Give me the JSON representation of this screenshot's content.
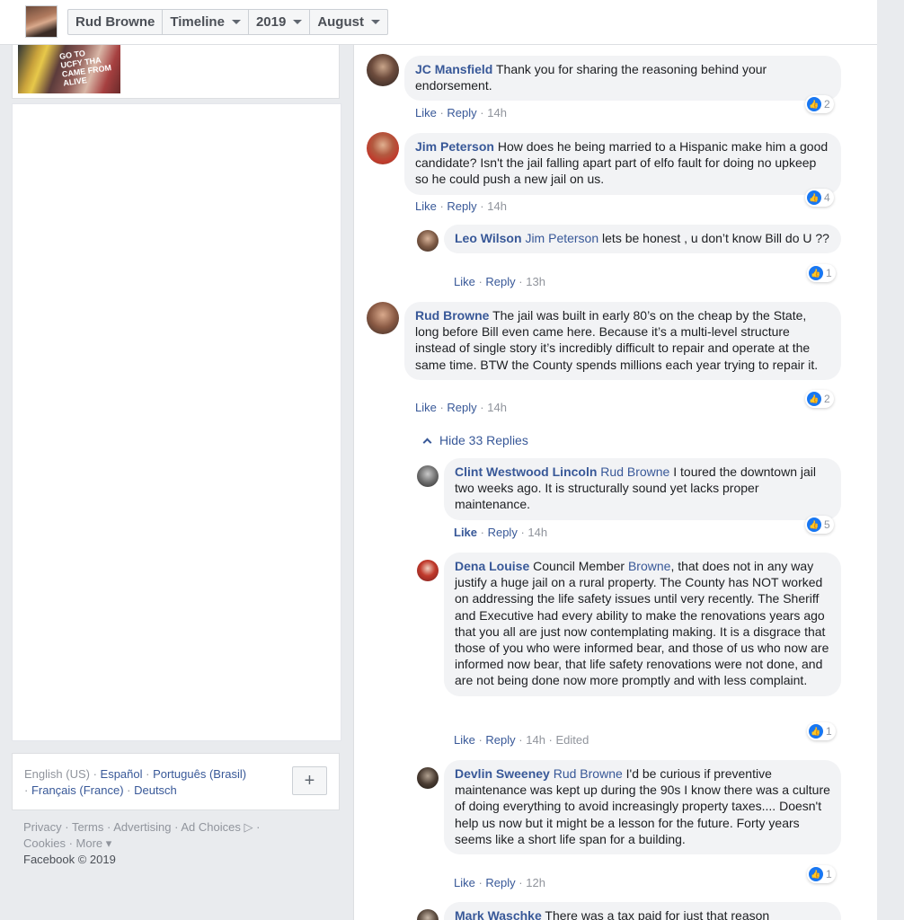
{
  "topbar": {
    "profile_name": "Rud Browne",
    "crumbs": [
      "Timeline",
      "2019",
      "August"
    ]
  },
  "left": {
    "photo_sign": "GO TO\nUCFY THA\nCAME FROM\nALIVE",
    "languages": {
      "current": "English (US)",
      "links": [
        "Español",
        "Português (Brasil)",
        "Français (France)",
        "Deutsch"
      ]
    },
    "footer": {
      "links": [
        "Privacy",
        "Terms",
        "Advertising",
        "Ad Choices",
        "Cookies",
        "More"
      ],
      "copyright": "Facebook © 2019"
    }
  },
  "comments": [
    {
      "author": "JC Mansfield",
      "mention": "",
      "text": "Thank you for sharing the reasoning behind your endorsement.",
      "like": "Like",
      "reply": "Reply",
      "time": "14h",
      "reactions": "2"
    },
    {
      "author": "Jim Peterson",
      "mention": "",
      "text": "How does he being married to a Hispanic make him a good candidate? Isn't the jail falling apart part of elfo fault for doing no upkeep so he could push a new jail on us.",
      "like": "Like",
      "reply": "Reply",
      "time": "14h",
      "reactions": "4"
    },
    {
      "author": "Leo Wilson",
      "mention": "Jim Peterson",
      "text": "lets be honest , u don’t know Bill do U ??",
      "like": "Like",
      "reply": "Reply",
      "time": "13h",
      "reactions": "1"
    },
    {
      "author": "Rud Browne",
      "mention": "",
      "text": "The jail was built in early 80’s on the cheap by the State, long before Bill even came here. Because it’s a multi-level structure instead of single story it’s incredibly difficult to repair and operate at the same time. BTW the County spends millions each year trying to repair it.",
      "like": "Like",
      "reply": "Reply",
      "time": "14h",
      "reactions": "2"
    },
    {
      "author": "Clint Westwood Lincoln",
      "mention": "Rud Browne",
      "text": "I toured the downtown jail two weeks ago. It is structurally sound yet lacks proper maintenance.",
      "like": "Like",
      "reply": "Reply",
      "time": "14h",
      "reactions": "5"
    },
    {
      "author": "Dena Louise",
      "mention": "",
      "text_before": "Council Member ",
      "inline_mention": "Browne",
      "text": ", that does not in any way justify a huge jail on a rural property. The County has NOT worked on addressing the life safety issues until very recently. The Sheriff and Executive had every ability to make the renovations years ago that you all are just now contemplating making. It is a disgrace that those of you who were informed bear, and those of us who now are informed now bear, that life safety renovations were not done, and are not being done now more promptly and with less complaint.",
      "like": "Like",
      "reply": "Reply",
      "time": "14h",
      "edited": "Edited",
      "reactions": "1"
    },
    {
      "author": "Devlin Sweeney",
      "mention": "Rud Browne",
      "text": "I'd be curious if preventive maintenance was kept up during the 90s I know there was a culture of doing everything to avoid increasingly property taxes.... Doesn't help us now but it might be a lesson for the future. Forty years seems like a short life span for a building.",
      "like": "Like",
      "reply": "Reply",
      "time": "12h",
      "reactions": "1"
    },
    {
      "author": "Mark Waschke",
      "mention": "",
      "text": "There was a tax paid for just that reason"
    }
  ],
  "hide_replies": "Hide 33 Replies",
  "colors": {
    "link": "#385898",
    "bubble": "#f2f3f5",
    "like_blue": "#1877f2"
  }
}
